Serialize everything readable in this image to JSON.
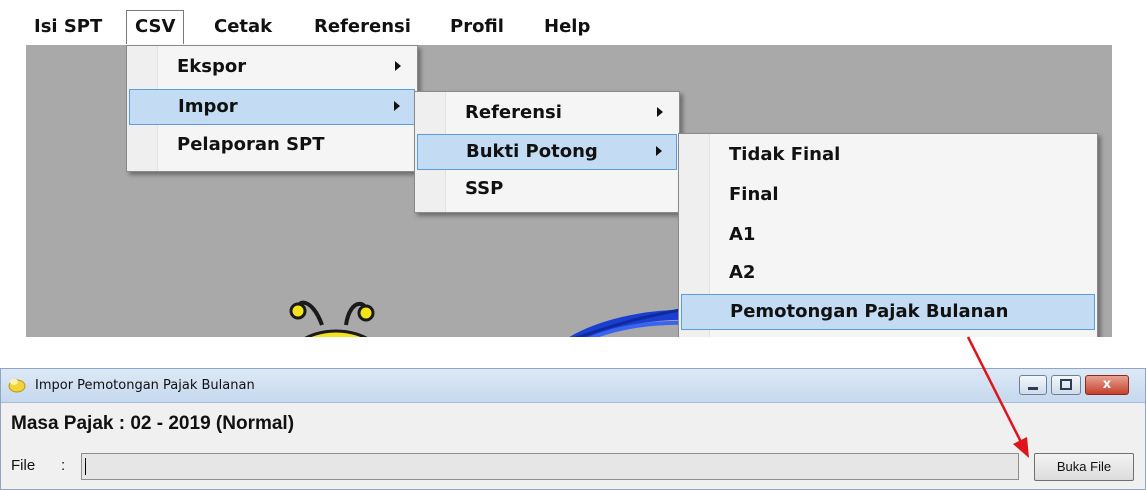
{
  "menubar": {
    "items": [
      "Isi SPT",
      "CSV",
      "Cetak",
      "Referensi",
      "Profil",
      "Help"
    ]
  },
  "csv_menu": {
    "items": [
      "Ekspor",
      "Impor",
      "Pelaporan SPT"
    ]
  },
  "impor_menu": {
    "items": [
      "Referensi",
      "Bukti Potong",
      "SSP"
    ]
  },
  "bukti_potong_menu": {
    "items": [
      "Tidak Final",
      "Final",
      "A1",
      "A2",
      "Pemotongan Pajak Bulanan"
    ]
  },
  "dialog": {
    "title": "Impor Pemotongan Pajak Bulanan",
    "masa_pajak": "Masa Pajak :  02 - 2019 (Normal)",
    "file_label": "File",
    "file_colon": ":",
    "file_value": "",
    "open_button": "Buka File",
    "close_glyph": "x"
  },
  "colors": {
    "highlight": "#c3dcf4",
    "highlight_border": "#5a9ede",
    "annotation_arrow": "#e0141b"
  }
}
